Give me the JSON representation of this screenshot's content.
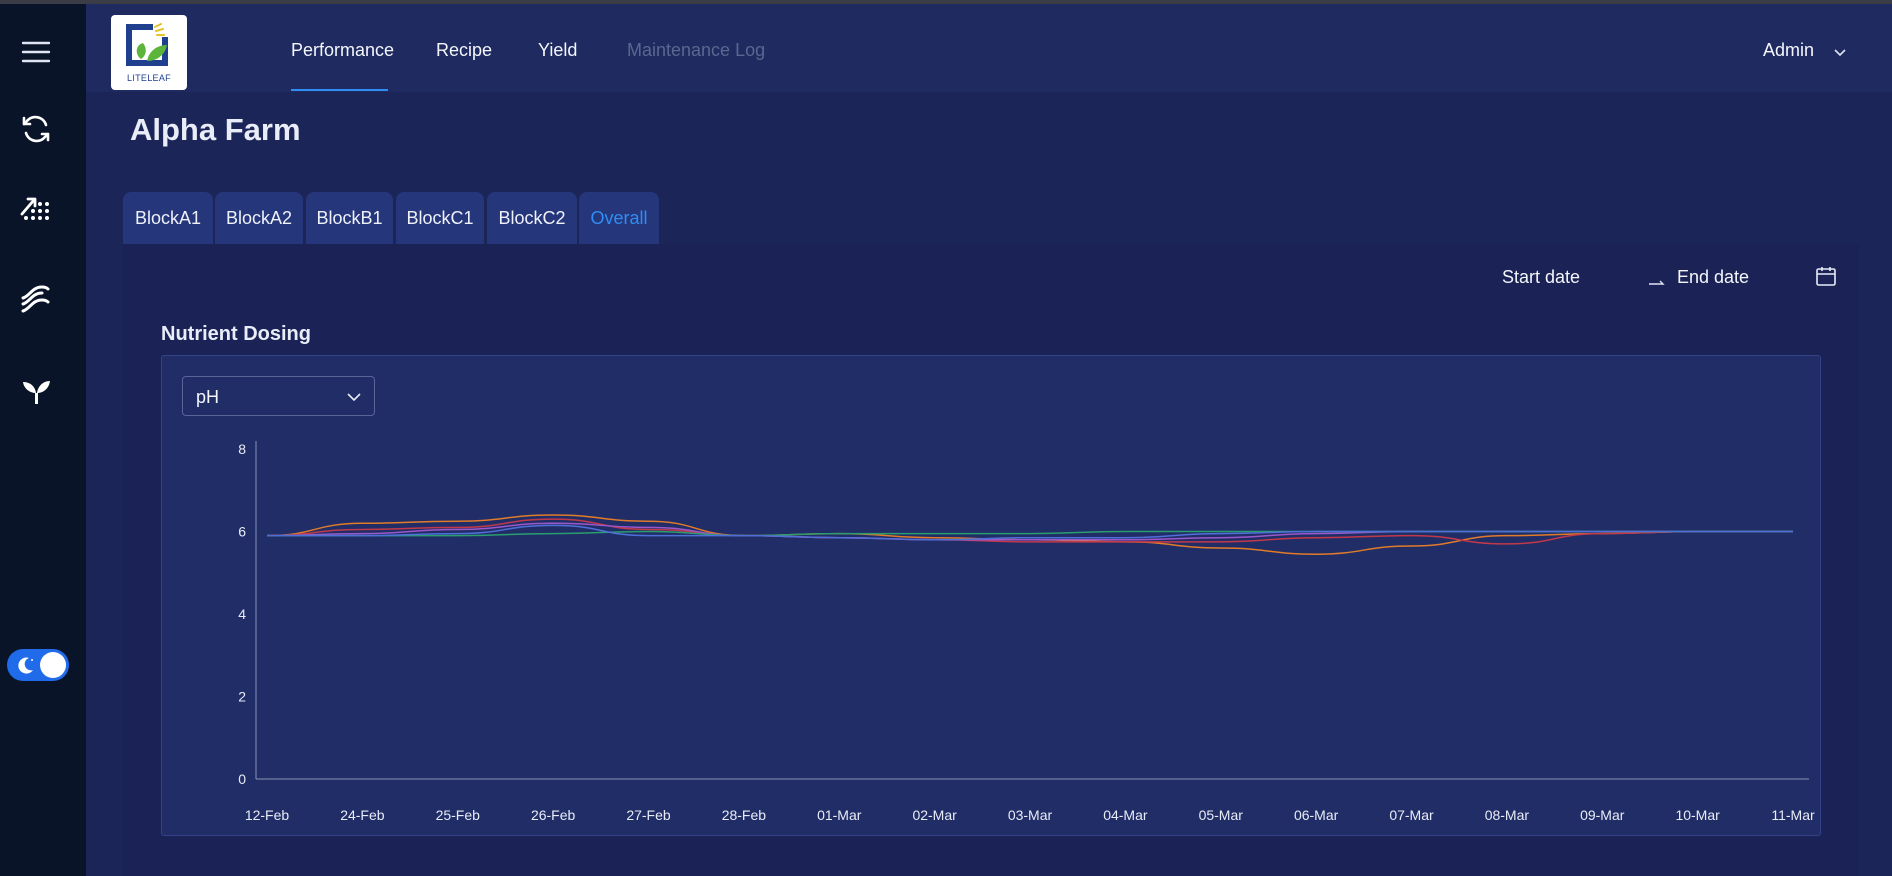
{
  "header": {
    "logo_text": "LITELEAF",
    "nav": [
      {
        "label": "Performance",
        "active": true
      },
      {
        "label": "Recipe"
      },
      {
        "label": "Yield"
      },
      {
        "label": "Maintenance Log",
        "disabled": true
      }
    ],
    "user": "Admin"
  },
  "sidebar": {
    "items": [
      "menu-icon",
      "refresh-icon",
      "growth-chart-icon",
      "wave-icon",
      "sprout-icon"
    ],
    "theme_toggle": {
      "icon": "moon-icon",
      "on": true
    }
  },
  "page": {
    "title": "Alpha Farm",
    "tabs": [
      {
        "label": "BlockA1"
      },
      {
        "label": "BlockA2"
      },
      {
        "label": "BlockB1"
      },
      {
        "label": "BlockC1"
      },
      {
        "label": "BlockC2"
      },
      {
        "label": "Overall",
        "active": true
      }
    ],
    "date_range": {
      "start_placeholder": "Start date",
      "end_placeholder": "End date"
    },
    "section_title": "Nutrient Dosing",
    "metric_select": {
      "value": "pH"
    }
  },
  "colors": {
    "accent": "#2f8df3",
    "series": [
      "#e07b2a",
      "#c0394b",
      "#9a58c9",
      "#2a9d6f",
      "#4f6fd8"
    ]
  },
  "chart_data": {
    "type": "line",
    "title": "",
    "xlabel": "",
    "ylabel": "",
    "ylim": [
      0,
      8
    ],
    "yticks": [
      0,
      2,
      4,
      6,
      8
    ],
    "categories": [
      "12-Feb",
      "24-Feb",
      "25-Feb",
      "26-Feb",
      "27-Feb",
      "28-Feb",
      "01-Mar",
      "02-Mar",
      "03-Mar",
      "04-Mar",
      "05-Mar",
      "06-Mar",
      "07-Mar",
      "08-Mar",
      "09-Mar",
      "10-Mar",
      "11-Mar"
    ],
    "series": [
      {
        "values": [
          5.9,
          6.2,
          6.25,
          6.4,
          6.25,
          5.9,
          5.95,
          5.85,
          5.8,
          5.75,
          5.6,
          5.45,
          5.65,
          5.9,
          5.95,
          6.0,
          6.0
        ]
      },
      {
        "values": [
          5.9,
          6.05,
          6.1,
          6.3,
          6.05,
          5.9,
          5.85,
          5.8,
          5.75,
          5.75,
          5.75,
          5.85,
          5.9,
          5.7,
          5.95,
          6.0,
          6.0
        ]
      },
      {
        "values": [
          5.9,
          5.95,
          6.05,
          6.2,
          6.1,
          5.9,
          5.85,
          5.8,
          5.8,
          5.8,
          5.85,
          5.95,
          6.0,
          6.0,
          6.0,
          6.0,
          6.0
        ]
      },
      {
        "values": [
          5.9,
          5.9,
          5.9,
          5.95,
          6.0,
          5.9,
          5.95,
          5.95,
          5.95,
          6.0,
          6.0,
          6.0,
          6.0,
          6.0,
          6.0,
          6.0,
          6.0
        ]
      },
      {
        "values": [
          5.9,
          5.9,
          5.95,
          6.15,
          5.9,
          5.9,
          5.85,
          5.8,
          5.85,
          5.85,
          5.95,
          6.0,
          6.0,
          6.0,
          6.0,
          6.0,
          6.0
        ]
      }
    ],
    "grid": false,
    "legend": "none"
  }
}
